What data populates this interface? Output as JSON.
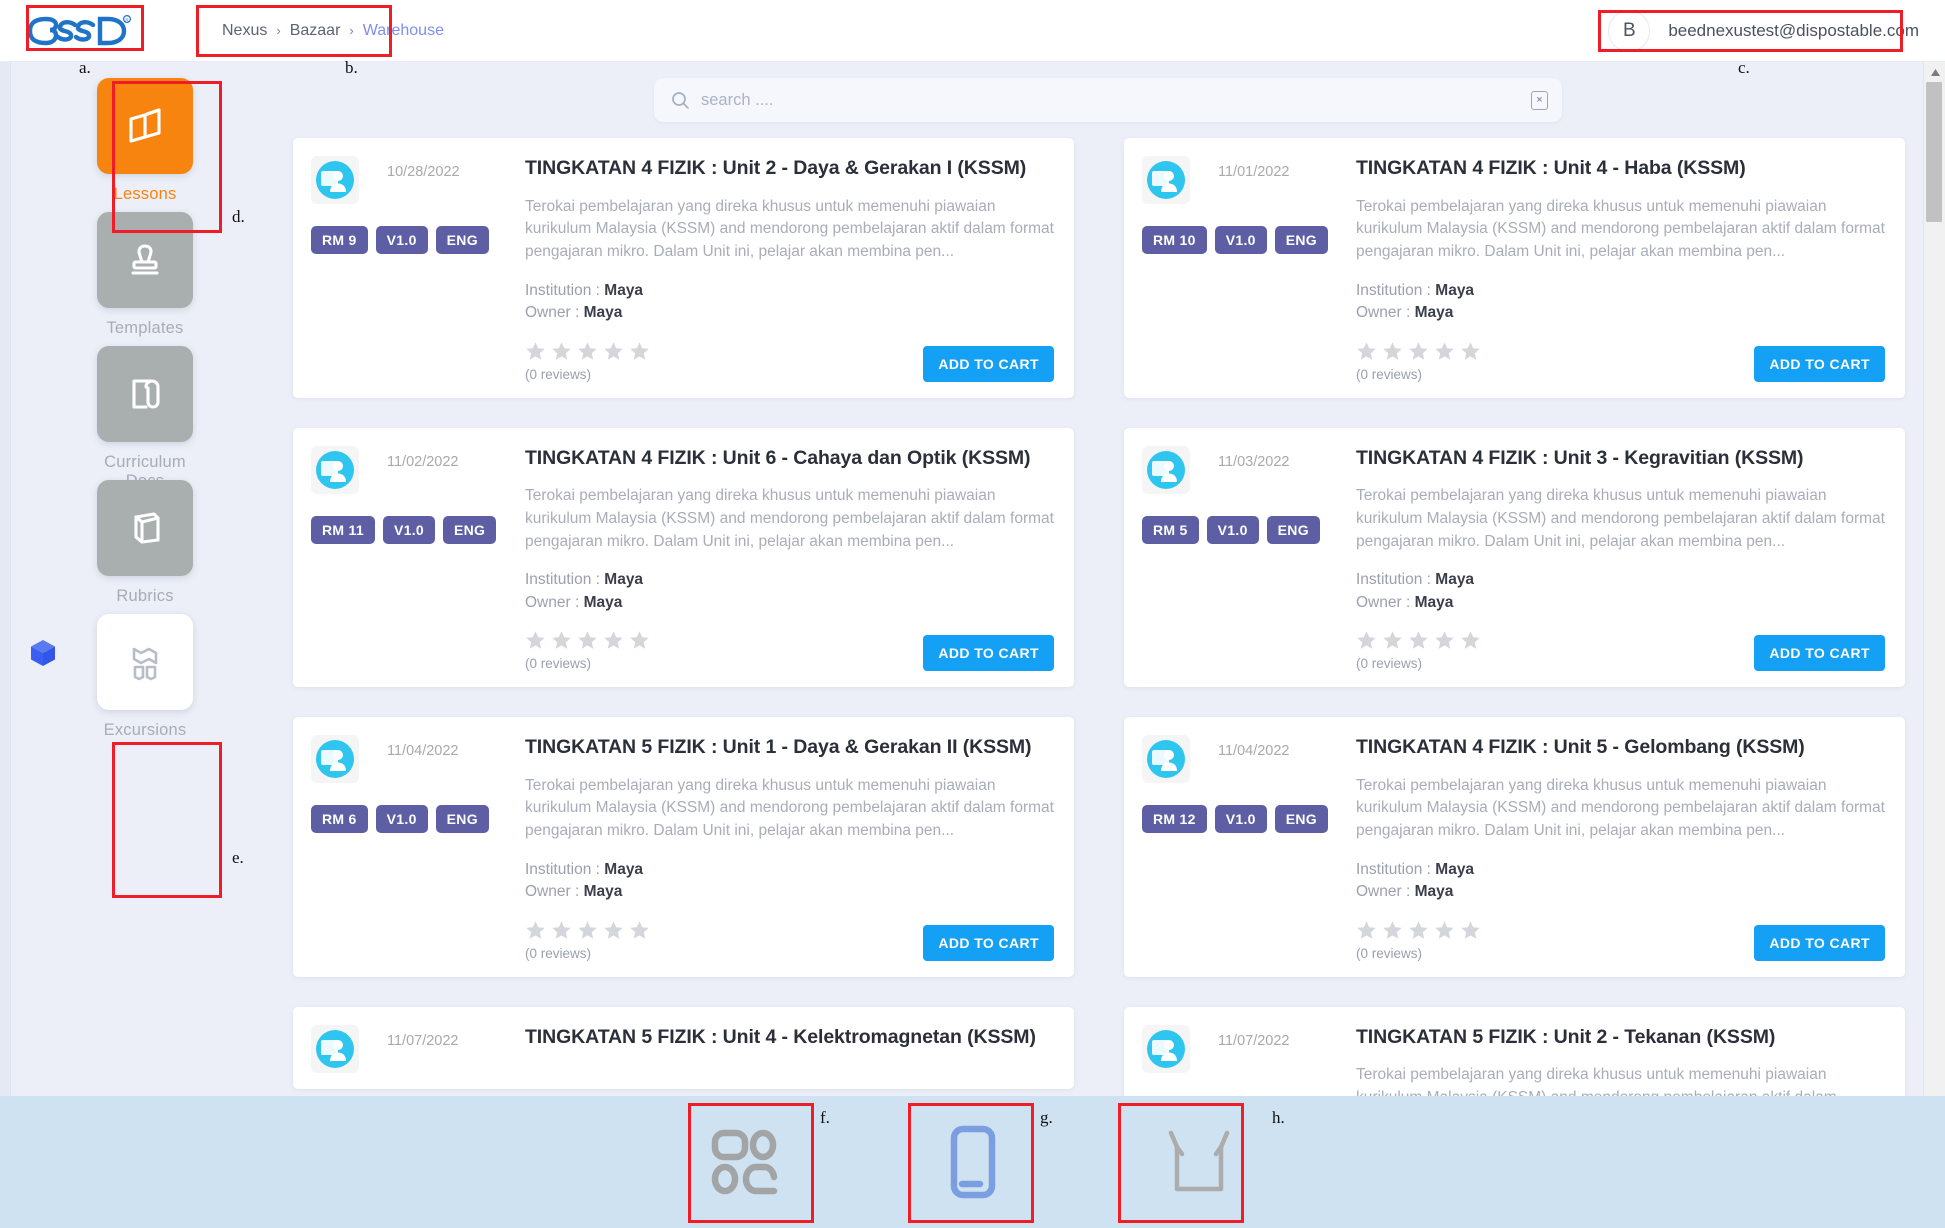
{
  "header": {
    "logo_alt": "BEED",
    "breadcrumb": [
      {
        "label": "Nexus",
        "active": false
      },
      {
        "label": "Bazaar",
        "active": false
      },
      {
        "label": "Warehouse",
        "active": true
      }
    ],
    "separator": "›",
    "account": {
      "initial": "B",
      "email": "beednexustest@dispostable.com"
    }
  },
  "search": {
    "placeholder": "search ....",
    "value": "",
    "clear_label": "×"
  },
  "sidebar": {
    "items": [
      {
        "label": "Lessons",
        "icon": "open-book-icon",
        "state": "active"
      },
      {
        "label": "Templates",
        "icon": "stamp-icon",
        "state": "inactive"
      },
      {
        "label": "Curriculum Docs",
        "icon": "document-clip-icon",
        "state": "inactive"
      },
      {
        "label": "Rubrics",
        "icon": "stacked-sheets-icon",
        "state": "inactive"
      },
      {
        "label": "Excursions",
        "icon": "map-fold-icon",
        "state": "white"
      }
    ]
  },
  "cards": {
    "left": [
      {
        "date": "10/28/2022",
        "title": "TINGKATAN 4 FIZIK : Unit 2 - Daya & Gerakan I (KSSM)",
        "description": "Terokai pembelajaran yang direka khusus untuk memenuhi piawaian kurikulum Malaysia (KSSM) and mendorong pembelajaran aktif dalam format pengajaran mikro. Dalam Unit ini, pelajar akan membina pen...",
        "price": "RM 9",
        "version": "V1.0",
        "language": "ENG",
        "institution_label": "Institution",
        "institution": "Maya",
        "owner_label": "Owner",
        "owner": "Maya",
        "reviews": "(0 reviews)",
        "stars": 5,
        "rating": 0,
        "cta": "ADD TO CART"
      },
      {
        "date": "11/02/2022",
        "title": "TINGKATAN 4 FIZIK : Unit 6 - Cahaya dan Optik (KSSM)",
        "description": "Terokai pembelajaran yang direka khusus untuk memenuhi piawaian kurikulum Malaysia (KSSM) and mendorong pembelajaran aktif dalam format pengajaran mikro. Dalam Unit ini, pelajar akan membina pen...",
        "price": "RM 11",
        "version": "V1.0",
        "language": "ENG",
        "institution_label": "Institution",
        "institution": "Maya",
        "owner_label": "Owner",
        "owner": "Maya",
        "reviews": "(0 reviews)",
        "stars": 5,
        "rating": 0,
        "cta": "ADD TO CART"
      },
      {
        "date": "11/04/2022",
        "title": "TINGKATAN 5 FIZIK : Unit 1 - Daya & Gerakan II (KSSM)",
        "description": "Terokai pembelajaran yang direka khusus untuk memenuhi piawaian kurikulum Malaysia (KSSM) and mendorong pembelajaran aktif dalam format pengajaran mikro. Dalam Unit ini, pelajar akan membina pen...",
        "price": "RM 6",
        "version": "V1.0",
        "language": "ENG",
        "institution_label": "Institution",
        "institution": "Maya",
        "owner_label": "Owner",
        "owner": "Maya",
        "reviews": "(0 reviews)",
        "stars": 5,
        "rating": 0,
        "cta": "ADD TO CART"
      },
      {
        "date": "11/07/2022",
        "title": "TINGKATAN 5 FIZIK : Unit 4 - Kelektromagnetan (KSSM)",
        "description": "",
        "price": "",
        "version": "",
        "language": "",
        "institution_label": "",
        "institution": "",
        "owner_label": "",
        "owner": "",
        "reviews": "",
        "stars": 0,
        "rating": 0,
        "cta": ""
      }
    ],
    "right": [
      {
        "date": "11/01/2022",
        "title": "TINGKATAN 4 FIZIK : Unit 4 - Haba (KSSM)",
        "description": "Terokai pembelajaran yang direka khusus untuk memenuhi piawaian kurikulum Malaysia (KSSM) and mendorong pembelajaran aktif dalam format pengajaran mikro. Dalam Unit ini, pelajar akan membina pen...",
        "price": "RM 10",
        "version": "V1.0",
        "language": "ENG",
        "institution_label": "Institution",
        "institution": "Maya",
        "owner_label": "Owner",
        "owner": "Maya",
        "reviews": "(0 reviews)",
        "stars": 5,
        "rating": 0,
        "cta": "ADD TO CART"
      },
      {
        "date": "11/03/2022",
        "title": "TINGKATAN 4 FIZIK : Unit 3 - Kegravitian (KSSM)",
        "description": "Terokai pembelajaran yang direka khusus untuk memenuhi piawaian kurikulum Malaysia (KSSM) and mendorong pembelajaran aktif dalam format pengajaran mikro. Dalam Unit ini, pelajar akan membina pen...",
        "price": "RM 5",
        "version": "V1.0",
        "language": "ENG",
        "institution_label": "Institution",
        "institution": "Maya",
        "owner_label": "Owner",
        "owner": "Maya",
        "reviews": "(0 reviews)",
        "stars": 5,
        "rating": 0,
        "cta": "ADD TO CART"
      },
      {
        "date": "11/04/2022",
        "title": "TINGKATAN 4 FIZIK : Unit 5 - Gelombang (KSSM)",
        "description": "Terokai pembelajaran yang direka khusus untuk memenuhi piawaian kurikulum Malaysia (KSSM) and mendorong pembelajaran aktif dalam format pengajaran mikro. Dalam Unit ini, pelajar akan membina pen...",
        "price": "RM 12",
        "version": "V1.0",
        "language": "ENG",
        "institution_label": "Institution",
        "institution": "Maya",
        "owner_label": "Owner",
        "owner": "Maya",
        "reviews": "(0 reviews)",
        "stars": 5,
        "rating": 0,
        "cta": "ADD TO CART"
      },
      {
        "date": "11/07/2022",
        "title": "TINGKATAN 5 FIZIK : Unit 2 - Tekanan (KSSM)",
        "description": "Terokai pembelajaran yang direka khusus untuk memenuhi piawaian kurikulum Malaysia (KSSM) and mendorong pembelajaran aktif dalam",
        "price": "",
        "version": "",
        "language": "",
        "institution_label": "",
        "institution": "",
        "owner_label": "",
        "owner": "",
        "reviews": "",
        "stars": 0,
        "rating": 0,
        "cta": ""
      }
    ]
  },
  "bottom_bar": {
    "icons": [
      {
        "name": "blocks-layout-icon",
        "color": "#a2a4a6"
      },
      {
        "name": "mobile-device-icon",
        "color": "#7a9ee0"
      },
      {
        "name": "open-box-icon",
        "color": "#acacac"
      }
    ]
  },
  "annotations": [
    {
      "key": "a."
    },
    {
      "key": "b."
    },
    {
      "key": "c."
    },
    {
      "key": "d."
    },
    {
      "key": "e."
    },
    {
      "key": "f."
    },
    {
      "key": "g."
    },
    {
      "key": "h."
    }
  ],
  "colors": {
    "accent_orange": "#f7840e",
    "badge_purple": "#5d5ea3",
    "cta_blue": "#14a0f5",
    "page_bg": "#eceff7",
    "bottom_bar_bg": "#cfe2f1",
    "annotation_red": "#ee1d26"
  }
}
